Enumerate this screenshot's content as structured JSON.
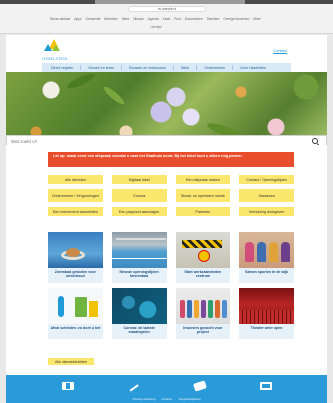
{
  "browser": {
    "url": "m-utrecht.nl",
    "bookmarks": [
      "Nieuw tabblad",
      "Apps",
      "Gemeente",
      "Berichten",
      "Werk",
      "Nieuws",
      "Agenda",
      "Kaart",
      "Post",
      "Documenten",
      "Diensten",
      "Overige favorieten",
      "Meer"
    ],
    "reading_list": "Leeslijst"
  },
  "header": {
    "logo_text": "IJSSELSTEIN",
    "contact_link": "Contact"
  },
  "nav": {
    "items": [
      "Direct regelen",
      "Wonen en leven",
      "Bouwen en verbouwen",
      "Werk",
      "Ondernemen",
      "Over IJsselstein"
    ]
  },
  "search": {
    "placeholder": "Wat zoekt u?"
  },
  "alert": {
    "text": "Let op: maak eerst een afspraak voordat u naar het Stadhuis komt. Bij het loket kunt u alleen nog pinnen."
  },
  "quick_links": [
    {
      "label": "Alle diensten",
      "tall": false
    },
    {
      "label": "Digitaal loket",
      "tall": false
    },
    {
      "label": "Een afspraak maken",
      "tall": false
    },
    {
      "label": "Contact / Openingstijden",
      "tall": false
    },
    {
      "label": "Ondernemen / Vergunningen",
      "tall": true
    },
    {
      "label": "Corona",
      "tall": true
    },
    {
      "label": "Straat- en openbare ruimte",
      "tall": true
    },
    {
      "label": "Vacatures",
      "tall": true
    },
    {
      "label": "Een evenement aanmelden",
      "tall": false
    },
    {
      "label": "Een paspoort aanvragen",
      "tall": false
    },
    {
      "label": "Parkeren",
      "tall": false
    },
    {
      "label": "Verhuizing doorgeven",
      "tall": false
    }
  ],
  "news": [
    {
      "title": "Zwembad gesloten voor onderhoud",
      "image": "pool"
    },
    {
      "title": "Nieuwe openingstijden binnenbad",
      "image": "poolhall"
    },
    {
      "title": "Start werkzaamheden centrum",
      "image": "works"
    },
    {
      "title": "Samen sporten in de wijk",
      "image": "people"
    },
    {
      "title": "Afval scheiden: zo doet u het",
      "image": "waste"
    },
    {
      "title": "Corona: de laatste maatregelen",
      "image": "virus"
    },
    {
      "title": "Inwoners gezocht voor project",
      "image": "crowd"
    },
    {
      "title": "Theater weer open",
      "image": "theatre"
    }
  ],
  "all_news_button": "Alle nieuwsberichten",
  "footer": {
    "icons": [
      "facebook-icon",
      "brush-icon",
      "card-icon",
      "tv-icon"
    ],
    "links": [
      "Privacyverklaring",
      "Cookies",
      "Toegankelijkheid"
    ]
  }
}
